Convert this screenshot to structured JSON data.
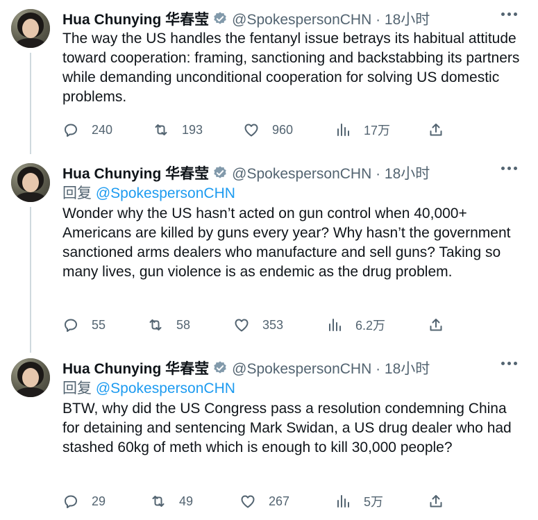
{
  "tweets": [
    {
      "author": {
        "name": "Hua Chunying 华春莹",
        "handle": "@SpokespersonCHN",
        "time": "18小时"
      },
      "reply_prefix": "",
      "reply_to": "",
      "text": "The way the US handles the fentanyl issue betrays its habitual attitude toward cooperation: framing, sanctioning and backstabbing its partners while demanding unconditional cooperation for solving US domestic problems.",
      "stats": {
        "replies": "240",
        "retweets": "193",
        "likes": "960",
        "views": "17万"
      }
    },
    {
      "author": {
        "name": "Hua Chunying 华春莹",
        "handle": "@SpokespersonCHN",
        "time": "18小时"
      },
      "reply_prefix": "回复",
      "reply_to": "@SpokespersonCHN",
      "text": "Wonder why the US hasn’t acted on gun control when 40,000+ Americans are killed by guns every year? Why hasn’t the government sanctioned arms dealers who manufacture and sell guns? Taking so many lives, gun violence is as endemic as the drug problem.",
      "stats": {
        "replies": "55",
        "retweets": "58",
        "likes": "353",
        "views": "6.2万"
      }
    },
    {
      "author": {
        "name": "Hua Chunying 华春莹",
        "handle": "@SpokespersonCHN",
        "time": "18小时"
      },
      "reply_prefix": "回复",
      "reply_to": "@SpokespersonCHN",
      "text": "BTW, why did the US Congress pass a resolution condemning China for detaining and sentencing Mark Swidan, a US drug dealer who had stashed 60kg of meth which is enough to kill 30,000 people?",
      "stats": {
        "replies": "29",
        "retweets": "49",
        "likes": "267",
        "views": "5万"
      }
    }
  ],
  "icons": {
    "reply": "reply-icon",
    "retweet": "retweet-icon",
    "like": "like-icon",
    "views": "views-icon",
    "share": "share-icon",
    "verified": "verified-icon",
    "more": "more-icon"
  },
  "colors": {
    "accent": "#1d9bf0",
    "secondary_text": "#536471",
    "thread_line": "#cfd9de"
  }
}
